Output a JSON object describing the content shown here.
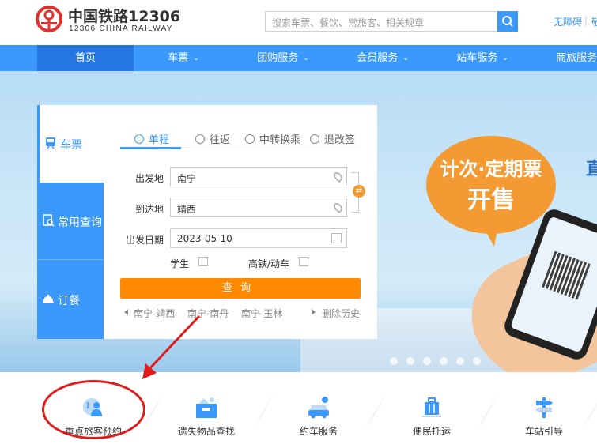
{
  "header": {
    "logo_cn": "中国铁路12306",
    "logo_en": "12306 CHINA RAILWAY",
    "search_placeholder": "搜索车票、餐饮、常旅客、相关规章",
    "access_label": "无障碍",
    "access_sep": "|",
    "access_next": "敬",
    "brand_color": "#3b99fc",
    "logo_color": "#e0322c"
  },
  "nav": {
    "items": [
      {
        "label": "首页",
        "active": true
      },
      {
        "label": "车票",
        "caret": "⌄"
      },
      {
        "label": "团购服务",
        "caret": "⌄"
      },
      {
        "label": "会员服务",
        "caret": "⌄"
      },
      {
        "label": "站车服务",
        "caret": "⌄"
      },
      {
        "label": "商旅服务",
        "caret": "⌄"
      }
    ]
  },
  "banner": {
    "bubble_line1": "计次·定期票",
    "bubble_line2": "开售",
    "edge_text": "直",
    "dot_count": 6,
    "accent_color": "#f39a33"
  },
  "ticket_panel": {
    "tabs": [
      {
        "label": "车票",
        "icon": "train-icon",
        "active": true
      },
      {
        "label": "常用查询",
        "icon": "query-icon"
      },
      {
        "label": "订餐",
        "icon": "bell-icon"
      }
    ],
    "modes": [
      {
        "label": "单程",
        "active": true
      },
      {
        "label": "往返"
      },
      {
        "label": "中转换乘"
      },
      {
        "label": "退改签"
      }
    ],
    "from_label": "出发地",
    "from_value": "南宁",
    "to_label": "到达地",
    "to_value": "靖西",
    "date_label": "出发日期",
    "date_value": "2023-05-10",
    "swap_glyph": "⇄",
    "student_label": "学生",
    "gaotie_label": "高铁/动车",
    "query_label": "查询",
    "history": [
      "南宁-靖西",
      "南宁-南丹",
      "南宁-玉林"
    ],
    "clear_history": "删除历史",
    "query_color": "#ff8a00"
  },
  "services": [
    {
      "label": "重点旅客预约",
      "icon": "priority-passenger-icon"
    },
    {
      "label": "遗失物品查找",
      "icon": "lost-item-icon"
    },
    {
      "label": "约车服务",
      "icon": "car-icon"
    },
    {
      "label": "便民托运",
      "icon": "luggage-icon"
    },
    {
      "label": "车站引导",
      "icon": "signpost-icon"
    }
  ],
  "annotation": {
    "color": "#e11b1b"
  }
}
